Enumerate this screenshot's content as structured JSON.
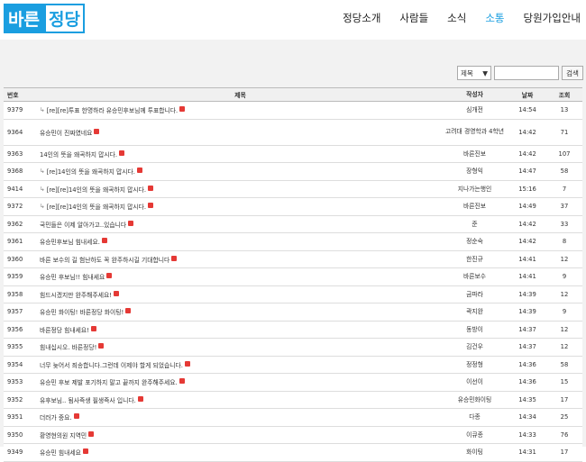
{
  "logo": {
    "part1": "바른",
    "part2": "정당"
  },
  "nav": [
    {
      "label": "정당소개",
      "active": false
    },
    {
      "label": "사람들",
      "active": false
    },
    {
      "label": "소식",
      "active": false
    },
    {
      "label": "소통",
      "active": true
    },
    {
      "label": "당원가입안내",
      "active": false
    }
  ],
  "search": {
    "select_value": "제목",
    "input_value": "",
    "button_label": "검색"
  },
  "table": {
    "headers": {
      "no": "번호",
      "title": "제목",
      "author": "작성자",
      "date": "날짜",
      "views": "조회"
    },
    "rows": [
      {
        "no": "9379",
        "title": "[re][re]투표 한명하라 유승민후보님께 투표합니다.",
        "reply": true,
        "author": "심개전",
        "date": "14:54",
        "views": "13"
      },
      {
        "no": "9364",
        "title": "유승민이 진짜였네요",
        "reply": false,
        "author": "고려대 경영학과 4학년",
        "date": "14:42",
        "views": "71"
      },
      {
        "no": "9363",
        "title": "14인의 뜻을 왜곡하지 맙시다.",
        "reply": false,
        "author": "바른진보",
        "date": "14:42",
        "views": "107"
      },
      {
        "no": "9368",
        "title": "[re]14인의 뜻을 왜곡하지 맙시다.",
        "reply": true,
        "author": "장형익",
        "date": "14:47",
        "views": "58"
      },
      {
        "no": "9414",
        "title": "[re][re]14인의 뜻을 왜곡하지 맙시다.",
        "reply": true,
        "author": "지나가는행인",
        "date": "15:16",
        "views": "7"
      },
      {
        "no": "9372",
        "title": "[re][re]14인의 뜻을 왜곡하지 맙시다.",
        "reply": true,
        "author": "바른진보",
        "date": "14:49",
        "views": "37"
      },
      {
        "no": "9362",
        "title": "국민들은 이제 알아가고..있습니다",
        "reply": false,
        "author": "준",
        "date": "14:42",
        "views": "33"
      },
      {
        "no": "9361",
        "title": "유승민후보님 힘내세요.",
        "reply": false,
        "author": "정순숙",
        "date": "14:42",
        "views": "8"
      },
      {
        "no": "9360",
        "title": "바른 보수의 길 험난하도 꼭 완주하시길 기대합니다",
        "reply": false,
        "author": "한진규",
        "date": "14:41",
        "views": "12"
      },
      {
        "no": "9359",
        "title": "유승민 후보님!! 힘내세요",
        "reply": false,
        "author": "바른보수",
        "date": "14:41",
        "views": "9"
      },
      {
        "no": "9358",
        "title": "힘드시겠지만 완주해주세요!",
        "reply": false,
        "author": "금파라",
        "date": "14:39",
        "views": "12"
      },
      {
        "no": "9357",
        "title": "유승민 화이팅! 바른정당 화이팅!",
        "reply": false,
        "author": "곽지완",
        "date": "14:39",
        "views": "9"
      },
      {
        "no": "9356",
        "title": "바른정당 힘내세요!",
        "reply": false,
        "author": "동방이",
        "date": "14:37",
        "views": "12"
      },
      {
        "no": "9355",
        "title": "힘내십시오. 바른정당!",
        "reply": false,
        "author": "김건우",
        "date": "14:37",
        "views": "12"
      },
      {
        "no": "9354",
        "title": "너무 늦어서 죄송합니다.그런데 이제야 할게 되었습니다.",
        "reply": false,
        "author": "정정형",
        "date": "14:36",
        "views": "58"
      },
      {
        "no": "9353",
        "title": "유승민 후보 제발 포기하지 말고 끝까지 완주해주세요.",
        "reply": false,
        "author": "이선이",
        "date": "14:36",
        "views": "15"
      },
      {
        "no": "9352",
        "title": "유후보님.. 됨사즉생 필생즉사 입니다.",
        "reply": false,
        "author": "유승민화이팅",
        "date": "14:35",
        "views": "17"
      },
      {
        "no": "9351",
        "title": "더러가 중요.",
        "reply": false,
        "author": "다종",
        "date": "14:34",
        "views": "25"
      },
      {
        "no": "9350",
        "title": "황영현의원 지역민",
        "reply": false,
        "author": "이큐종",
        "date": "14:33",
        "views": "76"
      },
      {
        "no": "9349",
        "title": "유승민 힘내세요",
        "reply": false,
        "author": "화이팅",
        "date": "14:31",
        "views": "17"
      }
    ]
  }
}
